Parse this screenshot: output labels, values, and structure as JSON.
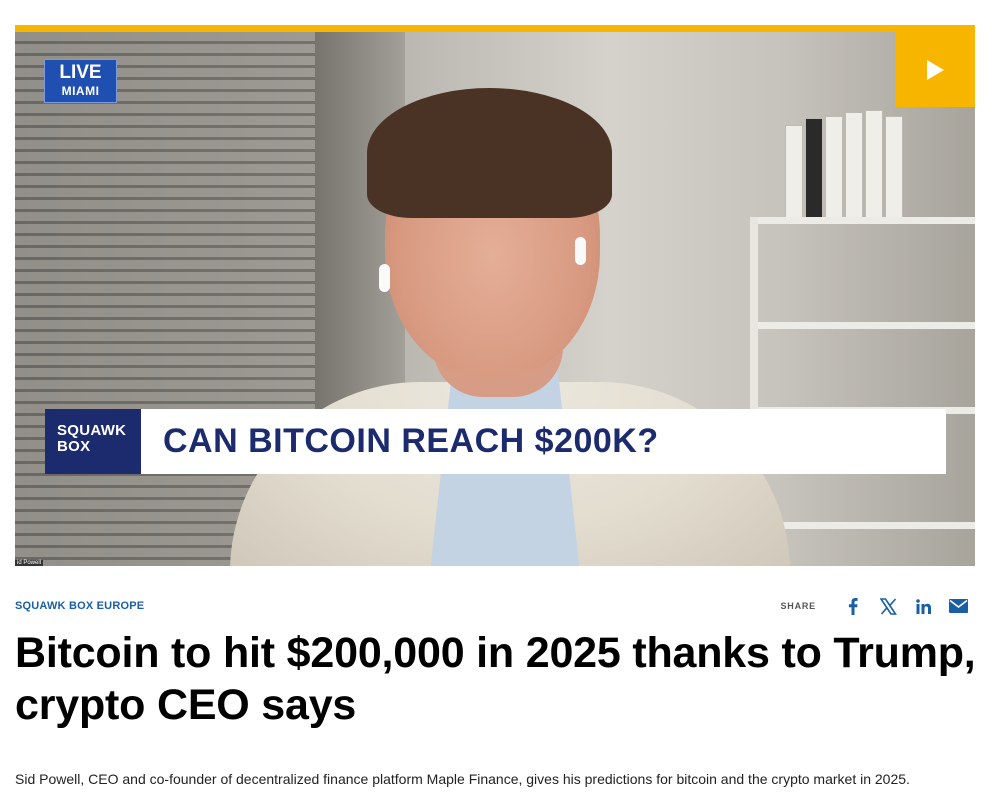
{
  "video": {
    "live_badge": {
      "text": "LIVE",
      "location": "MIAMI"
    },
    "chyron": {
      "show_line1": "SQUAWK",
      "show_line2": "BOX",
      "headline": "CAN BITCOIN REACH $200K?"
    },
    "name_tag": "id Powell",
    "play_icon": "play-icon"
  },
  "article": {
    "section": "SQUAWK BOX EUROPE",
    "share": {
      "label": "SHARE",
      "icons": [
        "facebook-icon",
        "x-icon",
        "linkedin-icon",
        "email-icon"
      ]
    },
    "headline": "Bitcoin to hit $200,000 in 2025 thanks to Trump, crypto CEO says",
    "dek": "Sid Powell, CEO and co-founder of decentralized finance platform Maple Finance, gives his predictions for bitcoin and the crypto market in 2025."
  },
  "colors": {
    "accent": "#f7b500",
    "chyron_navy": "#1b2b6e",
    "section_blue": "#1a5fa6",
    "share_blue": "#1a5fa6",
    "live_blue": "#1f4fb0"
  }
}
